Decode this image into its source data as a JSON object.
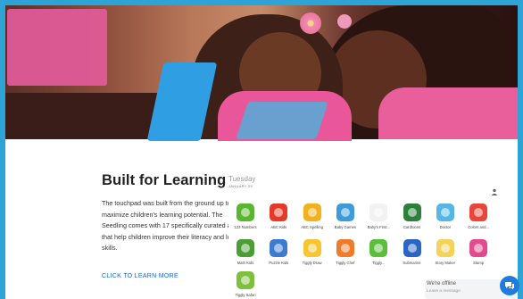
{
  "section": {
    "title": "Built for Learning",
    "description": "The touchpad was built from the ground up to maximize children's learning potential. The Seedling comes with 17 specifically curated apps that help children improve their literacy and logic skills.",
    "cta": "CLICK TO LEARN MORE"
  },
  "tablet": {
    "day": "Tuesday",
    "date": "JANUARY 29",
    "apps": [
      {
        "label": "123 Numbers",
        "icon": "numbers-icon",
        "color": "#5ab52f"
      },
      {
        "label": "ABC Kids",
        "icon": "abc-kids-icon",
        "color": "#e53a2a"
      },
      {
        "label": "ABC Spelling",
        "icon": "abc-spelling-icon",
        "color": "#f2b21e"
      },
      {
        "label": "Baby Games",
        "icon": "baby-games-icon",
        "color": "#3d9bd9"
      },
      {
        "label": "Baby's First...",
        "icon": "play-icon",
        "color": "#f2f2f2"
      },
      {
        "label": "Cardtoons",
        "icon": "cardtoons-icon",
        "color": "#2f7f3c"
      },
      {
        "label": "Doctor",
        "icon": "doctor-icon",
        "color": "#56b6e6"
      },
      {
        "label": "Colors and...",
        "icon": "colors-icon",
        "color": "#e8463a"
      },
      {
        "label": "Math Kids",
        "icon": "math-kids-icon",
        "color": "#4a9e35"
      },
      {
        "label": "Puzzle Kids",
        "icon": "puzzle-kids-icon",
        "color": "#3b7bd0"
      },
      {
        "label": "Tiggly Draw",
        "icon": "tiggly-draw-icon",
        "color": "#f7c531"
      },
      {
        "label": "Tiggly Chef",
        "icon": "tiggly-chef-icon",
        "color": "#ef7c2b"
      },
      {
        "label": "Tiggly...",
        "icon": "tiggly-icon",
        "color": "#5bbf3c"
      },
      {
        "label": "Submarine",
        "icon": "submarine-icon",
        "color": "#2a66c2"
      },
      {
        "label": "Story Maker",
        "icon": "story-maker-icon",
        "color": "#f3d35a"
      },
      {
        "label": "Stamp",
        "icon": "stamp-icon",
        "color": "#e24c8e"
      },
      {
        "label": "Tiggly Safari",
        "icon": "tiggly-safari-icon",
        "color": "#7fbf3e"
      }
    ]
  },
  "chat": {
    "status": "We're offline",
    "prompt": "Leave a message"
  }
}
